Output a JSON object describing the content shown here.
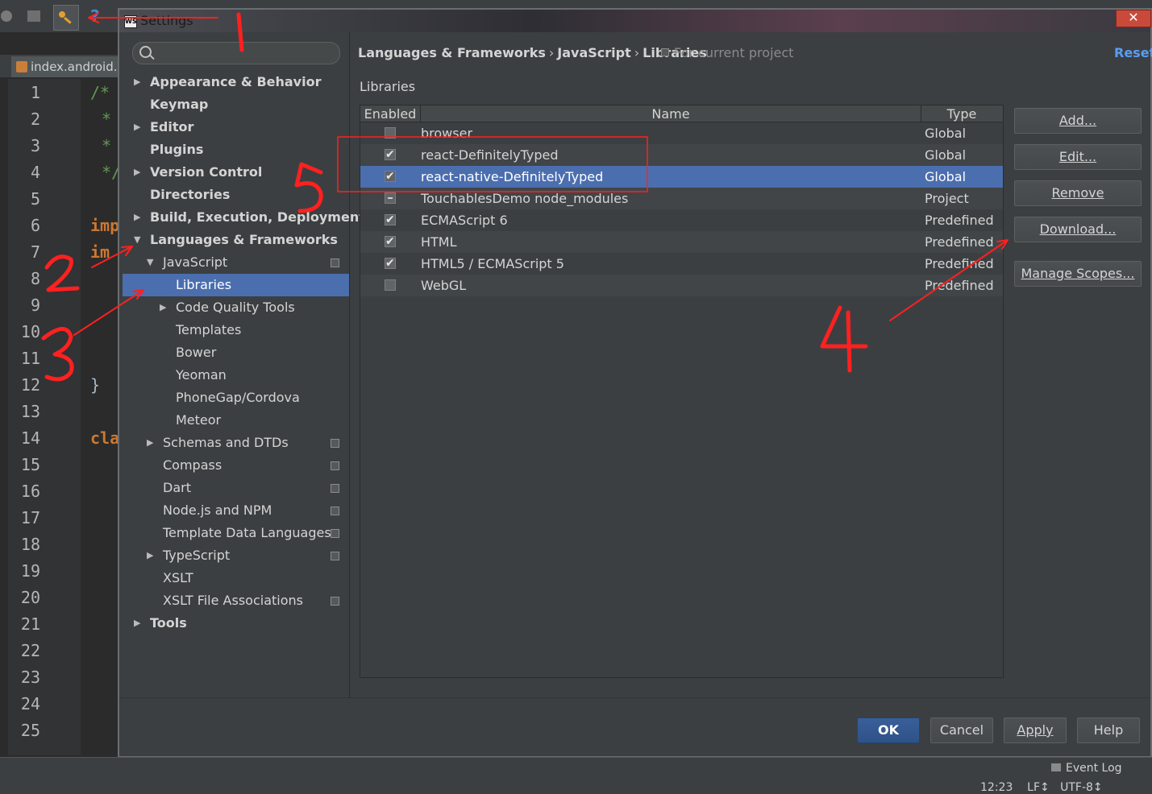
{
  "ide": {
    "tab_label": "index.android.",
    "line_numbers": [
      "1",
      "2",
      "3",
      "4",
      "5",
      "6",
      "7",
      "8",
      "9",
      "10",
      "11",
      "12",
      "13",
      "14",
      "15",
      "16",
      "17",
      "18",
      "19",
      "20",
      "21",
      "22",
      "23",
      "24",
      "25"
    ],
    "code_fragments": {
      "l1": "/*",
      "l2": "*",
      "l3": "*",
      "l4": "*/",
      "l6": "imp",
      "l7": "im",
      "l12": "}",
      "l14": "cla"
    },
    "status": {
      "event_log": "Event Log",
      "cursor": "12:23",
      "line_sep": "LF↕",
      "encoding": "UTF-8↕"
    }
  },
  "dialog": {
    "title": "Settings",
    "title_icon": "WS",
    "search": {
      "placeholder": ""
    },
    "nav": {
      "appearance": "Appearance & Behavior",
      "keymap": "Keymap",
      "editor": "Editor",
      "plugins": "Plugins",
      "vcs": "Version Control",
      "directories": "Directories",
      "build": "Build, Execution, Deployment",
      "langs": "Languages & Frameworks",
      "javascript": "JavaScript",
      "libraries": "Libraries",
      "code_quality": "Code Quality Tools",
      "templates": "Templates",
      "bower": "Bower",
      "yeoman": "Yeoman",
      "phonegap": "PhoneGap/Cordova",
      "meteor": "Meteor",
      "schemas": "Schemas and DTDs",
      "compass": "Compass",
      "dart": "Dart",
      "node": "Node.js and NPM",
      "template_data": "Template Data Languages",
      "typescript": "TypeScript",
      "xslt": "XSLT",
      "xslt_assoc": "XSLT File Associations",
      "tools": "Tools"
    },
    "breadcrumb": [
      "Languages & Frameworks",
      "JavaScript",
      "Libraries"
    ],
    "breadcrumb_sep": "›",
    "scope_note": "For current project",
    "reset": "Reset",
    "group_label": "Libraries",
    "table": {
      "headers": {
        "enabled": "Enabled",
        "name": "Name",
        "type": "Type"
      },
      "rows": [
        {
          "name": "browser",
          "type": "Global",
          "state": "unchecked"
        },
        {
          "name": "react-DefinitelyTyped",
          "type": "Global",
          "state": "checked"
        },
        {
          "name": "react-native-DefinitelyTyped",
          "type": "Global",
          "state": "checked",
          "selected": true
        },
        {
          "name": "TouchablesDemo node_modules",
          "type": "Project",
          "state": "indeterminate"
        },
        {
          "name": "ECMAScript 6",
          "type": "Predefined",
          "state": "checked"
        },
        {
          "name": "HTML",
          "type": "Predefined",
          "state": "checked"
        },
        {
          "name": "HTML5 / ECMAScript 5",
          "type": "Predefined",
          "state": "checked"
        },
        {
          "name": "WebGL",
          "type": "Predefined",
          "state": "unchecked"
        }
      ]
    },
    "side_buttons": {
      "add": "Add...",
      "edit": "Edit...",
      "remove": "Remove",
      "download": "Download...",
      "manage_scopes": "Manage Scopes..."
    },
    "footer": {
      "ok": "OK",
      "cancel": "Cancel",
      "apply": "Apply",
      "help": "Help"
    }
  },
  "annotations": {
    "color": "#ff2020",
    "labels": [
      "1",
      "2",
      "3",
      "4",
      "5"
    ]
  }
}
